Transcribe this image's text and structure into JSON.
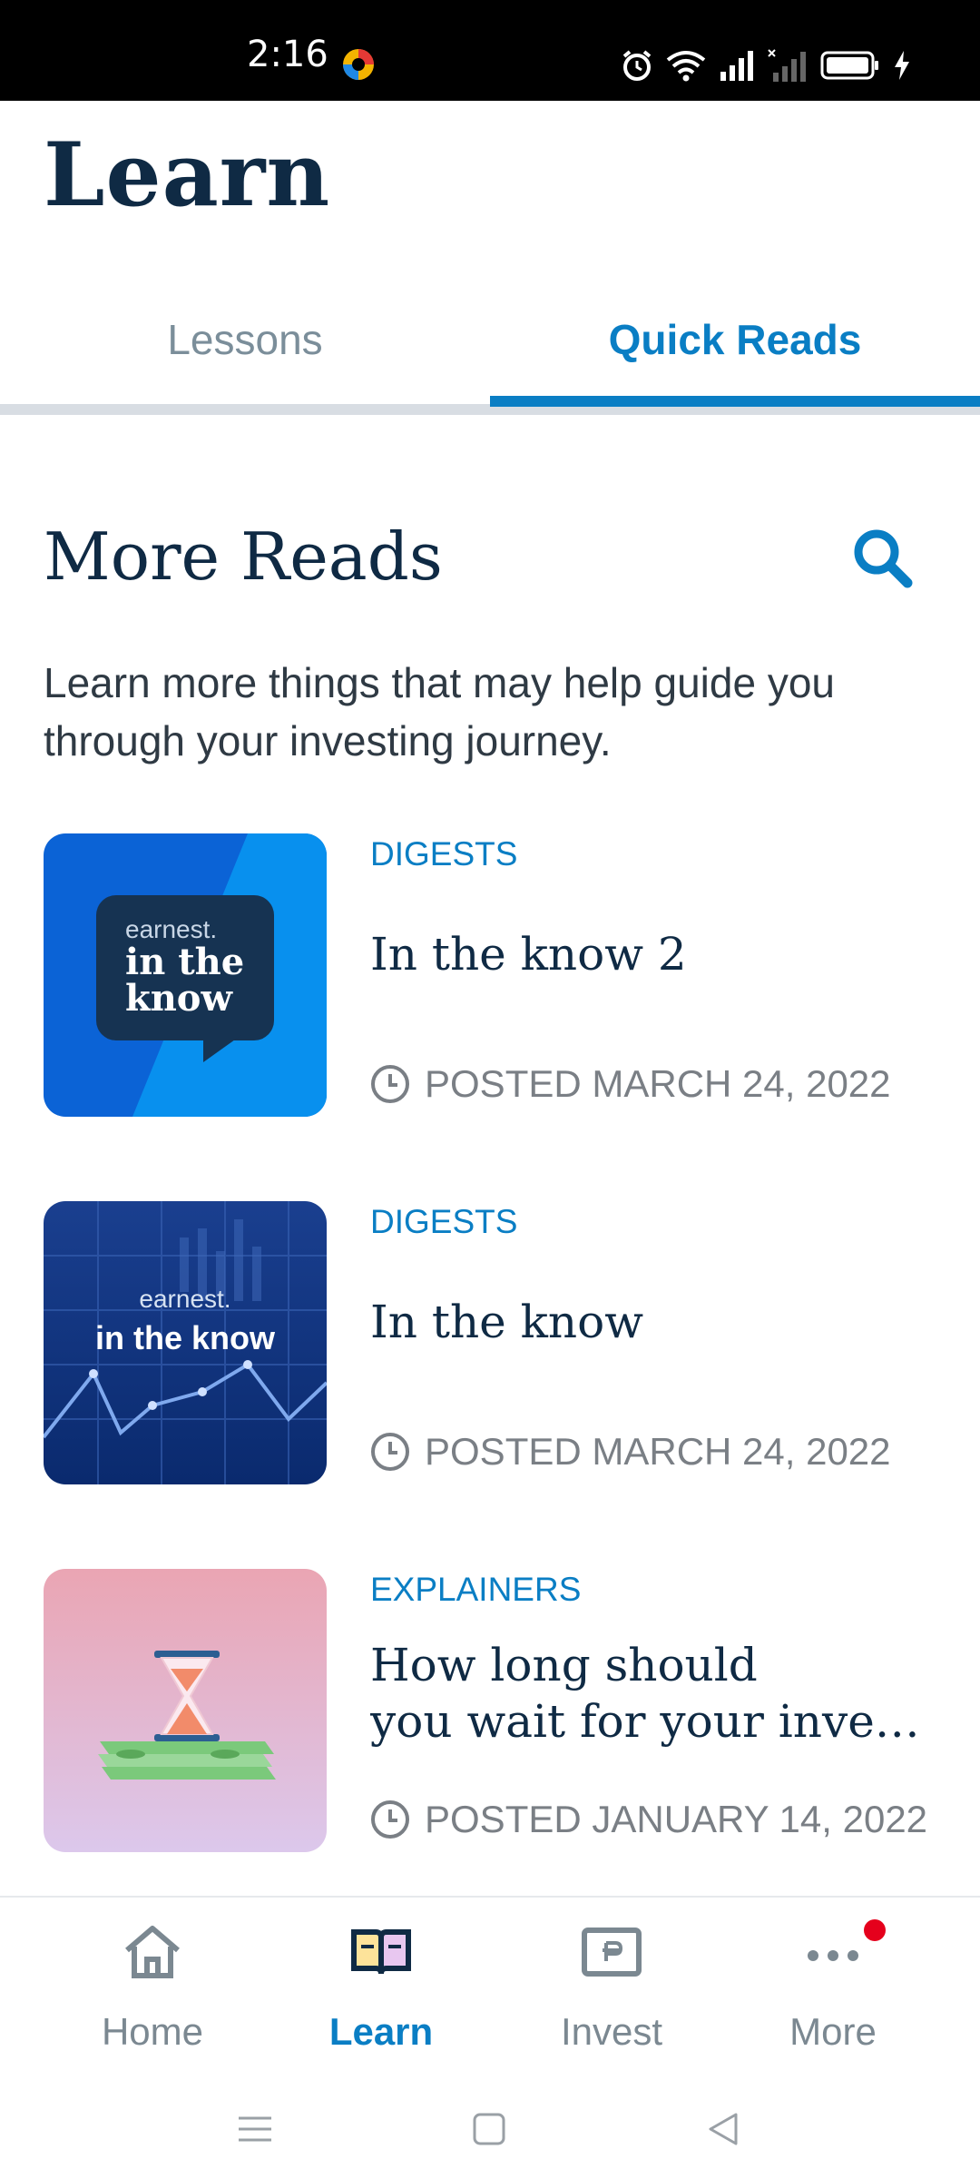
{
  "status_bar": {
    "time": "2:16",
    "icons": [
      "app-notification-icon",
      "alarm-icon",
      "wifi-icon",
      "signal-icon",
      "signal-off-icon",
      "battery-icon",
      "charging-icon"
    ]
  },
  "header": {
    "title": "Learn"
  },
  "tabs": [
    {
      "label": "Lessons",
      "active": false
    },
    {
      "label": "Quick Reads",
      "active": true
    }
  ],
  "section": {
    "title": "More Reads",
    "description": "Learn more things that may help guide you through your investing journey.",
    "search_icon": "search-icon"
  },
  "articles": [
    {
      "category": "DIGESTS",
      "title": "In the know 2",
      "posted": "POSTED MARCH 24, 2022",
      "thumb_brand": "earnest.",
      "thumb_line1": "in the",
      "thumb_line2": "know"
    },
    {
      "category": "DIGESTS",
      "title": "In the know",
      "posted": "POSTED MARCH 24, 2022",
      "thumb_brand": "earnest.",
      "thumb_line1": "in the know"
    },
    {
      "category": "EXPLAINERS",
      "title_line1": "How long should",
      "title_line2": "you wait for your inve…",
      "posted": "POSTED JANUARY 14, 2022"
    }
  ],
  "bottom_nav": [
    {
      "label": "Home",
      "icon": "home-icon",
      "active": false
    },
    {
      "label": "Learn",
      "icon": "book-icon",
      "active": true
    },
    {
      "label": "Invest",
      "icon": "invest-icon",
      "active": false
    },
    {
      "label": "More",
      "icon": "more-dots-icon",
      "active": false,
      "badge": true
    }
  ],
  "colors": {
    "accent": "#0a7ec4",
    "navy": "#0f2a44",
    "muted": "#7a7f85",
    "badge": "#e5001c"
  }
}
